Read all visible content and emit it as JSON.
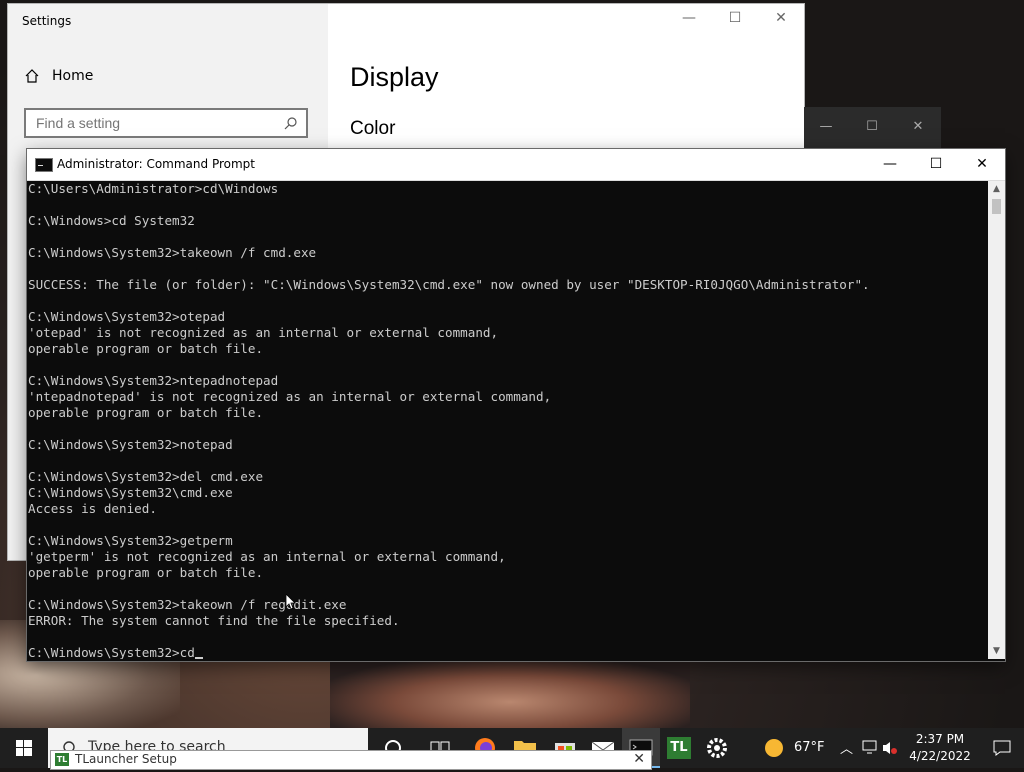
{
  "settings": {
    "title": "Settings",
    "home_label": "Home",
    "search_placeholder": "Find a setting",
    "heading": "Display",
    "subheading": "Color",
    "minimize": "—",
    "maximize": "☐",
    "close": "✕"
  },
  "background_window": {
    "minimize": "—",
    "maximize": "☐",
    "close": "✕"
  },
  "cmd": {
    "title": "Administrator: Command Prompt",
    "minimize": "—",
    "maximize": "☐",
    "close": "✕",
    "lines": [
      "C:\\Users\\Administrator>cd\\Windows",
      "",
      "C:\\Windows>cd System32",
      "",
      "C:\\Windows\\System32>takeown /f cmd.exe",
      "",
      "SUCCESS: The file (or folder): \"C:\\Windows\\System32\\cmd.exe\" now owned by user \"DESKTOP-RI0JQGO\\Administrator\".",
      "",
      "C:\\Windows\\System32>otepad",
      "'otepad' is not recognized as an internal or external command,",
      "operable program or batch file.",
      "",
      "C:\\Windows\\System32>ntepadnotepad",
      "'ntepadnotepad' is not recognized as an internal or external command,",
      "operable program or batch file.",
      "",
      "C:\\Windows\\System32>notepad",
      "",
      "C:\\Windows\\System32>del cmd.exe",
      "C:\\Windows\\System32\\cmd.exe",
      "Access is denied.",
      "",
      "C:\\Windows\\System32>getperm",
      "'getperm' is not recognized as an internal or external command,",
      "operable program or batch file.",
      "",
      "C:\\Windows\\System32>takeown /f regedit.exe",
      "ERROR: The system cannot find the file specified.",
      "",
      "C:\\Windows\\System32>cd"
    ]
  },
  "taskbar": {
    "search_placeholder": "Type here to search",
    "weather": "67°F",
    "time": "2:37 PM",
    "date": "4/22/2022",
    "icons": [
      "windows-start-icon",
      "search-icon",
      "task-view-icon",
      "firefox-icon",
      "file-explorer-icon",
      "store-icon",
      "mail-icon",
      "cmd-icon",
      "tlauncher-icon",
      "settings-gear-icon"
    ],
    "tlauncher_label": "TL"
  },
  "tlauncher_popup": {
    "title": "TLauncher Setup",
    "logo": "TL",
    "close": "✕"
  }
}
